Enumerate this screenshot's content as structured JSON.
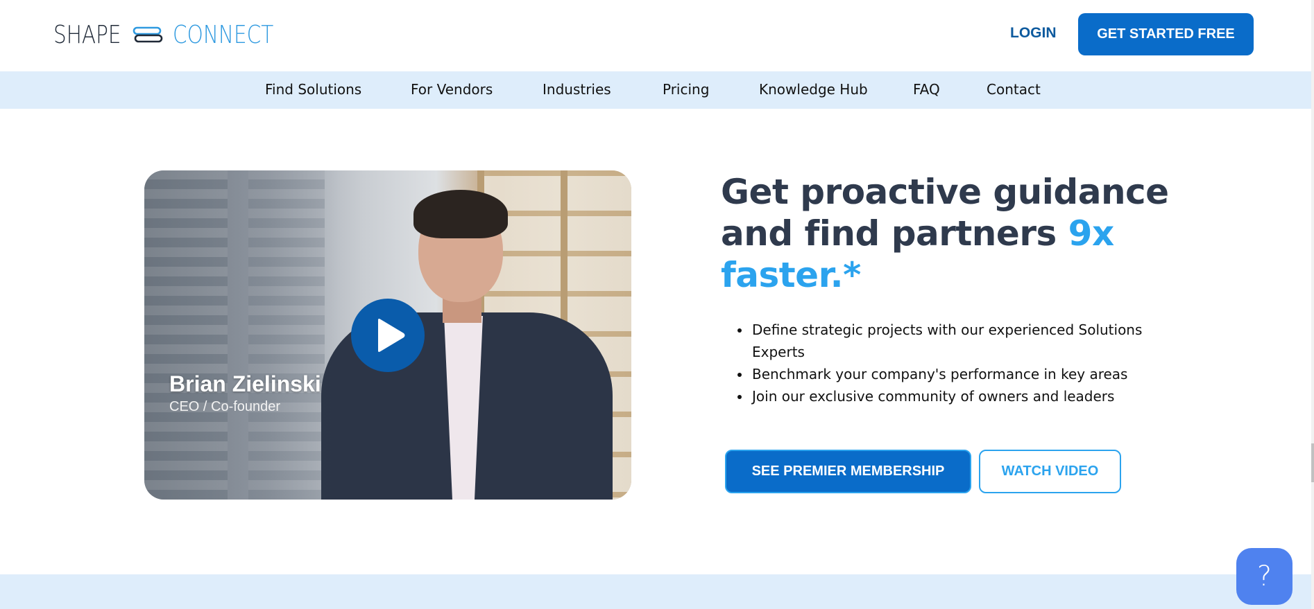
{
  "header": {
    "logo": {
      "word1": "SHAPE",
      "word2": "CONNECT",
      "icon": "link-icon"
    },
    "login_label": "LOGIN",
    "cta_label": "GET STARTED FREE"
  },
  "nav": {
    "items": [
      {
        "label": "Find Solutions"
      },
      {
        "label": "For Vendors"
      },
      {
        "label": "Industries"
      },
      {
        "label": "Pricing"
      },
      {
        "label": "Knowledge Hub"
      },
      {
        "label": "FAQ"
      },
      {
        "label": "Contact"
      }
    ]
  },
  "video": {
    "name": "Brian Zielinski",
    "role": "CEO / Co-founder",
    "play_icon": "play-icon"
  },
  "hero": {
    "headline_main": "Get proactive guidance and find partners ",
    "headline_accent": "9x faster.*",
    "bullets": [
      "Define strategic projects with our experienced Solutions Experts",
      "Benchmark your company's performance in key areas",
      "Join our exclusive community of owners and leaders"
    ],
    "primary_button": "SEE PREMIER MEMBERSHIP",
    "secondary_button": "WATCH VIDEO"
  },
  "help": {
    "label": "?",
    "icon": "help-icon"
  },
  "colors": {
    "brand_blue": "#0a6cc9",
    "accent_blue": "#2ba3ee",
    "nav_bg": "#deedfb",
    "heading": "#2f3a4d",
    "help_bg": "#4f82ef"
  }
}
